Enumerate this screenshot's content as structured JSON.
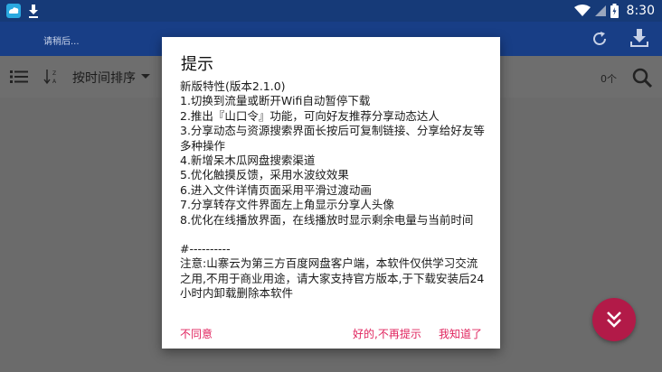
{
  "status_bar": {
    "time": "8:30",
    "icons": [
      "app-icon",
      "download-icon",
      "wifi-icon",
      "signal-icon",
      "battery-icon"
    ]
  },
  "app_bar": {
    "subtitle": "请稍后..."
  },
  "filter_bar": {
    "sort_label": "按时间排序",
    "count": "0个"
  },
  "dialog": {
    "title": "提示",
    "lines": [
      "新版特性(版本2.1.0)",
      "1.切换到流量或断开Wifi自动暂停下载",
      " 2.推出『山口令』功能，可向好友推荐分享动态达人",
      " 3.分享动态与资源搜索界面长按后可复制链接、分享给好友等多种操作",
      " 4.新增呆木瓜网盘搜索渠道",
      " 5.优化触摸反馈，采用水波纹效果",
      " 6.进入文件详情页面采用平滑过渡动画",
      " 7.分享转存文件界面左上角显示分享人头像",
      " 8.优化在线播放界面，在线播放时显示剩余电量与当前时间"
    ],
    "separator": "#----------",
    "notice": "注意:山寨云为第三方百度网盘客户端，本软件仅供学习交流之用,不用于商业用途，请大家支持官方版本,于下载安装后24小时内卸载删除本软件",
    "buttons": {
      "disagree": "不同意",
      "no_more": "好的,不再提示",
      "ok": "我知道了"
    }
  },
  "colors": {
    "status_bar": "#163a78",
    "app_bar": "#183e86",
    "accent": "#e0245e",
    "fab": "#b21a48",
    "overlay": "#6b6b6b"
  }
}
